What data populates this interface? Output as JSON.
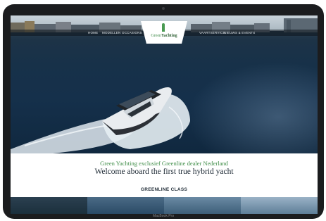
{
  "nav": {
    "left_items": [
      "HOME",
      "MODELLEN",
      "OCCASIONS"
    ],
    "right_items": [
      "VAARTSERVICE",
      "NIEUWS & EVENTS"
    ]
  },
  "logo": {
    "part1": "Green",
    "part2": "Yachting"
  },
  "content": {
    "tagline": "Green Yachting exclusief Greenline dealer Nederland",
    "headline": "Welcome aboard the first true hybrid yacht",
    "section_title": "GREENLINE CLASS"
  },
  "device": {
    "label": "MacBook Pro"
  },
  "colors": {
    "brand_green": "#3d8c46",
    "water": "#15304b",
    "text_dark": "#1e2a35"
  }
}
